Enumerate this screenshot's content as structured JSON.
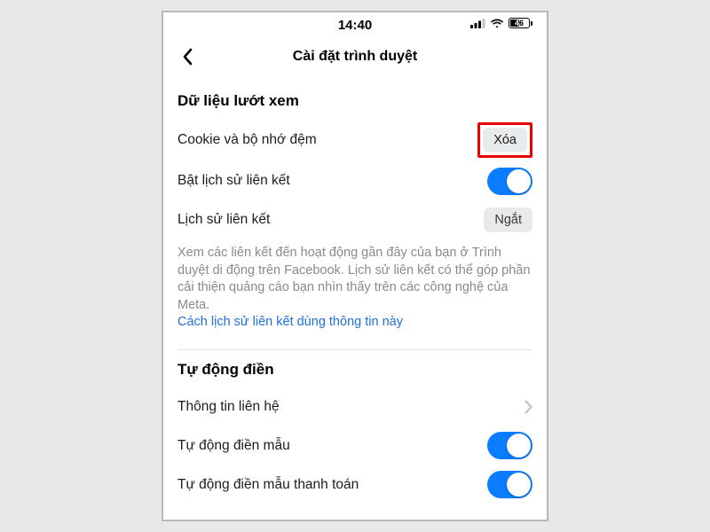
{
  "status": {
    "time": "14:40",
    "battery_pct": "46"
  },
  "header": {
    "title": "Cài đặt trình duyệt"
  },
  "section1": {
    "title": "Dữ liệu lướt xem",
    "rows": {
      "cookies": {
        "label": "Cookie và bộ nhớ đệm",
        "action": "Xóa"
      },
      "link_history_toggle": {
        "label": "Bật lịch sử liên kết"
      },
      "link_history": {
        "label": "Lịch sử liên kết",
        "action": "Ngắt"
      }
    },
    "help_text": "Xem các liên kết đến hoạt động gần đây của bạn ở Trình duyệt di động trên Facebook. Lịch sử liên kết có thể góp phần cải thiện quảng cáo bạn nhìn thấy trên các công nghệ của Meta.",
    "help_link": "Cách lịch sử liên kết dùng thông tin này"
  },
  "section2": {
    "title": "Tự động điền",
    "rows": {
      "contact": {
        "label": "Thông tin liên hệ"
      },
      "autofill": {
        "label": "Tự động điền mẫu"
      },
      "autofill_payment": {
        "label": "Tự động điền mẫu thanh toán"
      }
    }
  }
}
